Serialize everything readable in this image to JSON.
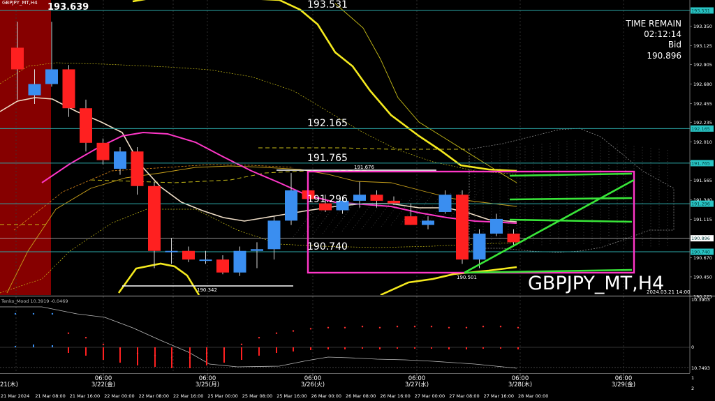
{
  "header": {
    "symbol_label": "GBPJPY_MT,H4",
    "big_price": "193.639"
  },
  "info_panel": {
    "time_remain_label": "TIME REMAIN",
    "time_remain_value": "02:12:14",
    "bid_label": "Bid",
    "bid_value": "190.896"
  },
  "watermark": {
    "symbol": "GBPJPY_MT,H4",
    "timestamp": "2024.03.21 14:00"
  },
  "oscillator": {
    "label": "Tenko_Mood 10.3919  -0.0469",
    "top_value": "10.3903",
    "zero_value": "0",
    "bottom_value": "10.7493"
  },
  "annotations": {
    "high_label": "191.676",
    "low_label": "190.501",
    "low2_label": "190.342"
  },
  "colors": {
    "background": "#000000",
    "bull_candle": "#3a8ef0",
    "bear_candle": "#ff2020",
    "level_line": "#2ca9a9",
    "magenta": "#ff37c8",
    "green": "#39e639",
    "yellow": "#f5ea1e",
    "sma_white": "#f1dfc8",
    "left_shade": "#860000"
  },
  "chart_data": {
    "type": "candlestick",
    "symbol": "GBPJPY_MT",
    "timeframe": "H4",
    "ylim": [
      190.275,
      193.531
    ],
    "price_axis_ticks": [
      "193.350",
      "193.125",
      "192.905",
      "192.680",
      "192.455",
      "192.235",
      "192.010",
      "191.785",
      "191.565",
      "191.340",
      "191.115",
      "190.895",
      "190.670",
      "190.450",
      "190.225"
    ],
    "horizontal_levels": [
      "193.531",
      "192.165",
      "191.765",
      "191.296",
      "190.740"
    ],
    "price_tags": [
      "193.531",
      "192.165",
      "191.765",
      "191.296",
      "190.896",
      "190.740"
    ],
    "candles": [
      {
        "o": 193.1,
        "h": 193.4,
        "l": 192.5,
        "c": 192.85
      },
      {
        "o": 192.55,
        "h": 192.85,
        "l": 192.45,
        "c": 192.68
      },
      {
        "o": 192.68,
        "h": 193.4,
        "l": 192.65,
        "c": 192.85
      },
      {
        "o": 192.85,
        "h": 192.9,
        "l": 192.3,
        "c": 192.4
      },
      {
        "o": 192.4,
        "h": 192.5,
        "l": 191.9,
        "c": 192.0
      },
      {
        "o": 192.0,
        "h": 192.05,
        "l": 191.75,
        "c": 191.8
      },
      {
        "o": 191.7,
        "h": 191.95,
        "l": 191.63,
        "c": 191.9
      },
      {
        "o": 191.9,
        "h": 191.95,
        "l": 191.4,
        "c": 191.5
      },
      {
        "o": 191.5,
        "h": 191.55,
        "l": 190.55,
        "c": 190.75
      },
      {
        "o": 190.75,
        "h": 190.9,
        "l": 190.6,
        "c": 190.75
      },
      {
        "o": 190.75,
        "h": 190.8,
        "l": 190.62,
        "c": 190.65
      },
      {
        "o": 190.65,
        "h": 190.75,
        "l": 190.6,
        "c": 190.65
      },
      {
        "o": 190.65,
        "h": 190.7,
        "l": 190.48,
        "c": 190.5
      },
      {
        "o": 190.5,
        "h": 190.8,
        "l": 190.46,
        "c": 190.75
      },
      {
        "o": 190.75,
        "h": 190.85,
        "l": 190.55,
        "c": 190.77
      },
      {
        "o": 190.77,
        "h": 191.15,
        "l": 190.65,
        "c": 191.1
      },
      {
        "o": 191.1,
        "h": 191.65,
        "l": 191.05,
        "c": 191.45
      },
      {
        "o": 191.45,
        "h": 191.5,
        "l": 191.3,
        "c": 191.35
      },
      {
        "o": 191.3,
        "h": 191.4,
        "l": 191.2,
        "c": 191.22
      },
      {
        "o": 191.22,
        "h": 191.38,
        "l": 191.18,
        "c": 191.33
      },
      {
        "o": 191.33,
        "h": 191.55,
        "l": 191.25,
        "c": 191.4
      },
      {
        "o": 191.4,
        "h": 191.45,
        "l": 191.25,
        "c": 191.33
      },
      {
        "o": 191.33,
        "h": 191.38,
        "l": 191.28,
        "c": 191.3
      },
      {
        "o": 191.15,
        "h": 191.3,
        "l": 191.05,
        "c": 191.05
      },
      {
        "o": 191.05,
        "h": 191.15,
        "l": 191.0,
        "c": 191.1
      },
      {
        "o": 191.2,
        "h": 191.45,
        "l": 191.18,
        "c": 191.4
      },
      {
        "o": 191.4,
        "h": 191.45,
        "l": 190.6,
        "c": 190.65
      },
      {
        "o": 190.65,
        "h": 191.0,
        "l": 190.55,
        "c": 190.95
      },
      {
        "o": 190.95,
        "h": 191.18,
        "l": 190.92,
        "c": 191.12
      },
      {
        "o": 190.95,
        "h": 191.0,
        "l": 190.8,
        "c": 190.85
      }
    ],
    "date_ticks": [
      "21 Mar 2024",
      "21 Mar 08:00",
      "21 Mar 16:00",
      "22 Mar 00:00",
      "22 Mar 08:00",
      "22 Mar 16:00",
      "25 Mar 00:00",
      "25 Mar 08:00",
      "25 Mar 16:00",
      "26 Mar 00:00",
      "26 Mar 08:00",
      "26 Mar 16:00",
      "27 Mar 00:00",
      "27 Mar 08:00",
      "27 Mar 16:00",
      "28 Mar 00:00"
    ],
    "session_ticks": [
      {
        "time": "06:00",
        "date": "3/22(金)"
      },
      {
        "time": "06:00",
        "date": "3/25(月)"
      },
      {
        "time": "06:00",
        "date": "3/26(火)"
      },
      {
        "time": "06:00",
        "date": "3/27(水)"
      },
      {
        "time": "06:00",
        "date": "3/28(木)"
      },
      {
        "time": "06:00",
        "date": "3/29(金)"
      }
    ],
    "first_session_date": "21(木)",
    "osc_axis_ticks": [
      "10.3903",
      "0",
      "10.7493",
      "1",
      "2"
    ]
  }
}
